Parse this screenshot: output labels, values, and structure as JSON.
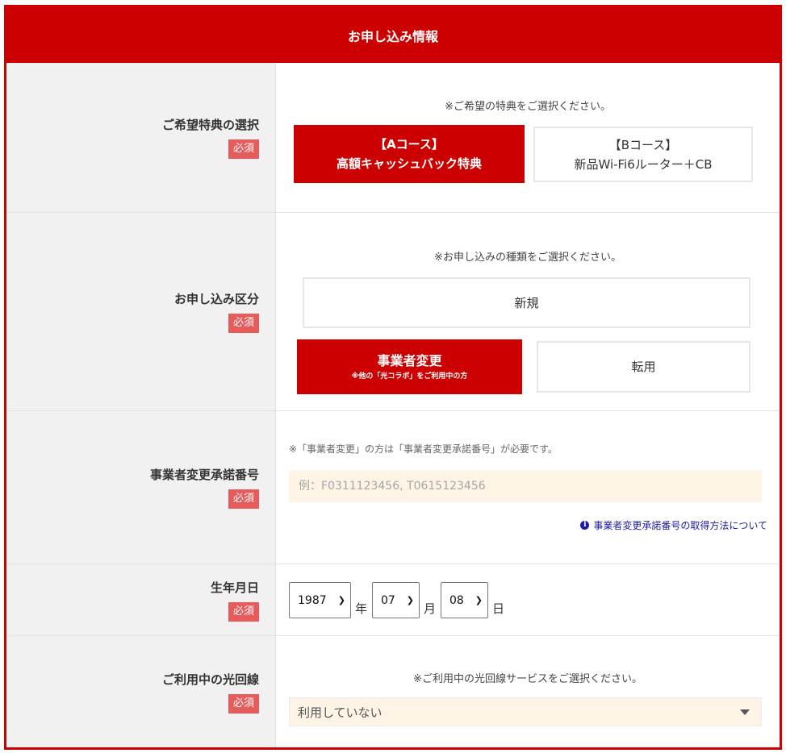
{
  "header": {
    "title": "お申し込み情報"
  },
  "required_label": "必須",
  "benefit": {
    "label": "ご希望特典の選択",
    "note": "※ご希望の特典をご選択ください。",
    "options": [
      {
        "line1": "【Aコース】",
        "line2": "高額キャッシュバック特典",
        "selected": true
      },
      {
        "line1": "【Bコース】",
        "line2": "新品Wi-Fi6ルーター＋CB",
        "selected": false
      }
    ]
  },
  "application_type": {
    "label": "お申し込み区分",
    "note": "※お申し込みの種類をご選択ください。",
    "options": [
      {
        "label": "新規",
        "selected": false
      },
      {
        "label": "事業者変更",
        "sub": "※他の「光コラボ」をご利用中の方",
        "selected": true
      },
      {
        "label": "転用",
        "selected": false
      }
    ]
  },
  "approval_number": {
    "label": "事業者変更承諾番号",
    "note": "※「事業者変更」の方は「事業者変更承諾番号」が必要です。",
    "placeholder": "例：F0311123456, T0615123456",
    "help_link": "事業者変更承諾番号の取得方法について"
  },
  "birth_date": {
    "label": "生年月日",
    "year": "1987",
    "year_unit": "年",
    "month": "07",
    "month_unit": "月",
    "day": "08",
    "day_unit": "日"
  },
  "current_line": {
    "label": "ご利用中の光回線",
    "note": "※ご利用中の光回線サービスをご選択ください。",
    "value": "利用していない"
  },
  "colors": {
    "brand": "#cc0000",
    "required_badge": "#e85b5b",
    "input_bg": "#fdf4e6",
    "link": "#1a1aa6"
  }
}
